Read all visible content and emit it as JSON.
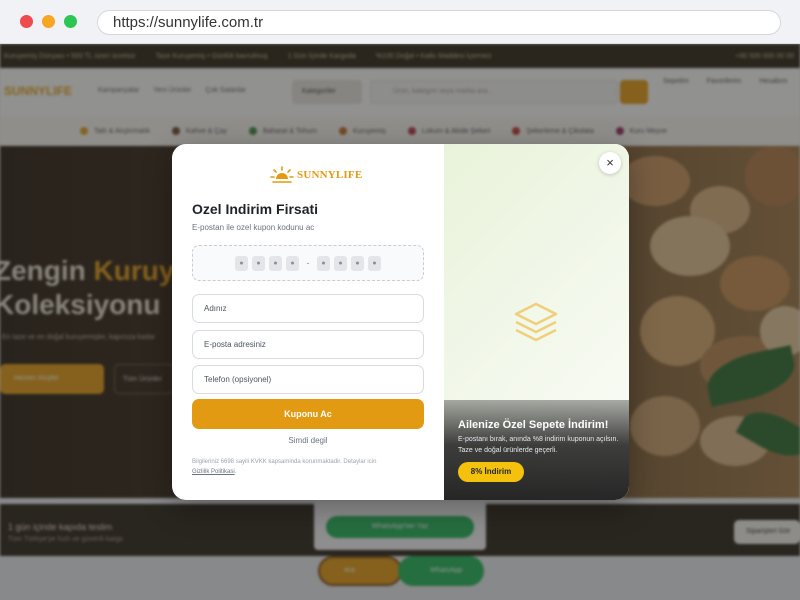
{
  "browser": {
    "url": "https://sunnylife.com.tr"
  },
  "background_page": {
    "topbar": [
      "Kuruyemiş Dünyası • 500 TL üzeri ücretsiz",
      "Taze Kuruyemiş • Günlük kavrulmuş",
      "1 Gün İçinde Kargoda",
      "%100 Doğal • Katkı Maddesi İçermez"
    ],
    "topbar_right": "+90 500 000 00 00",
    "logo": "SUNNYLIFE",
    "nav": [
      "Kampanyalar",
      "Yeni Ürünler",
      "Çok Satanlar"
    ],
    "category_button": "Kategoriler",
    "search_placeholder": "Ürün, kategori veya marka ara...",
    "header_icons": [
      "Sepetim",
      "Favorilerim",
      "Hesabım"
    ],
    "categories": [
      "Tatlı & Atıştırmalık",
      "Kahve & Çay",
      "Baharat & Tohum",
      "Kuruyemiş",
      "Lokum & Akide Şekeri",
      "Şekerleme & Çikolata",
      "Kuru Meyve"
    ],
    "hero_title_1": "Zengin ",
    "hero_title_accent": "Kuruyemiş",
    "hero_title_2": "Koleksiyonu",
    "hero_subtitle": "En taze ve en doğal kuruyemişler, kapınıza kadar",
    "hero_cta_primary": "Hemen Keşfet",
    "hero_cta_secondary": "Tüm Ürünler",
    "bottom_text_1": "1 gün içinde kapıda teslim",
    "bottom_text_2": "Tüm Türkiye'ye hızlı ve güvenli kargo",
    "bottom_button": "Siparişleri Gör",
    "whatsapp_button": "WhatsApp'tan Yaz",
    "float_button_1": "Ara",
    "float_button_2": "WhatsApp"
  },
  "modal": {
    "brand": "SUNNYLIFE",
    "title": "Ozel Indirim Firsati",
    "subtitle": "E-postan ile ozel kupon kodunu ac",
    "coupon_mask": [
      "●",
      "●",
      "●",
      "●",
      "-",
      "●",
      "●",
      "●",
      "●"
    ],
    "name_placeholder": "Adınız",
    "email_placeholder": "E-posta adresiniz",
    "phone_placeholder": "Telefon (opsiyonel)",
    "submit_label": "Kuponu Ac",
    "later_label": "Simdi degil",
    "legal_text": "Bilgileriniz 6698 sayili KVKK kapsaminda korunmaktadir. Detaylar icin",
    "legal_link": "Gizlilik Politikasi",
    "legal_end": ".",
    "promo_title": "Ailenize Özel Sepete İndirim!",
    "promo_description": "E-postanı bırak, anında %8 indirim kuponun açılsın. Taze ve doğal ürünlerde geçerli.",
    "promo_badge": "8% İndirim",
    "close_symbol": "×",
    "icons": {
      "logo": "sun-icon",
      "visual": "layers-icon",
      "close": "close-icon"
    },
    "colors": {
      "accent": "#e29a12",
      "badge": "#f4c20d",
      "panel_green": "#e9f3da"
    }
  }
}
